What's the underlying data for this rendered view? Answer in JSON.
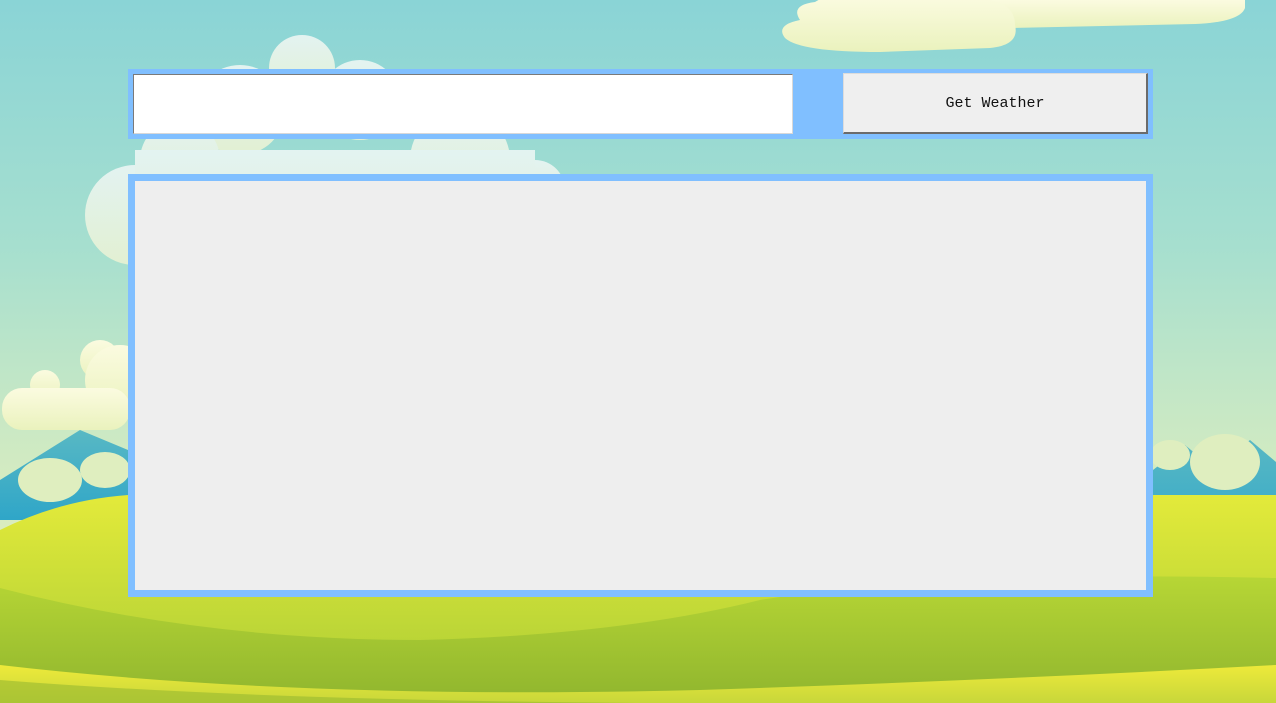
{
  "app": {
    "search": {
      "input_value": "",
      "input_placeholder": "",
      "button_label": "Get Weather"
    },
    "result": {
      "text": ""
    }
  },
  "colors": {
    "frame_accent": "#80bfff",
    "result_background": "#eeeeee",
    "button_background": "#efefef"
  }
}
